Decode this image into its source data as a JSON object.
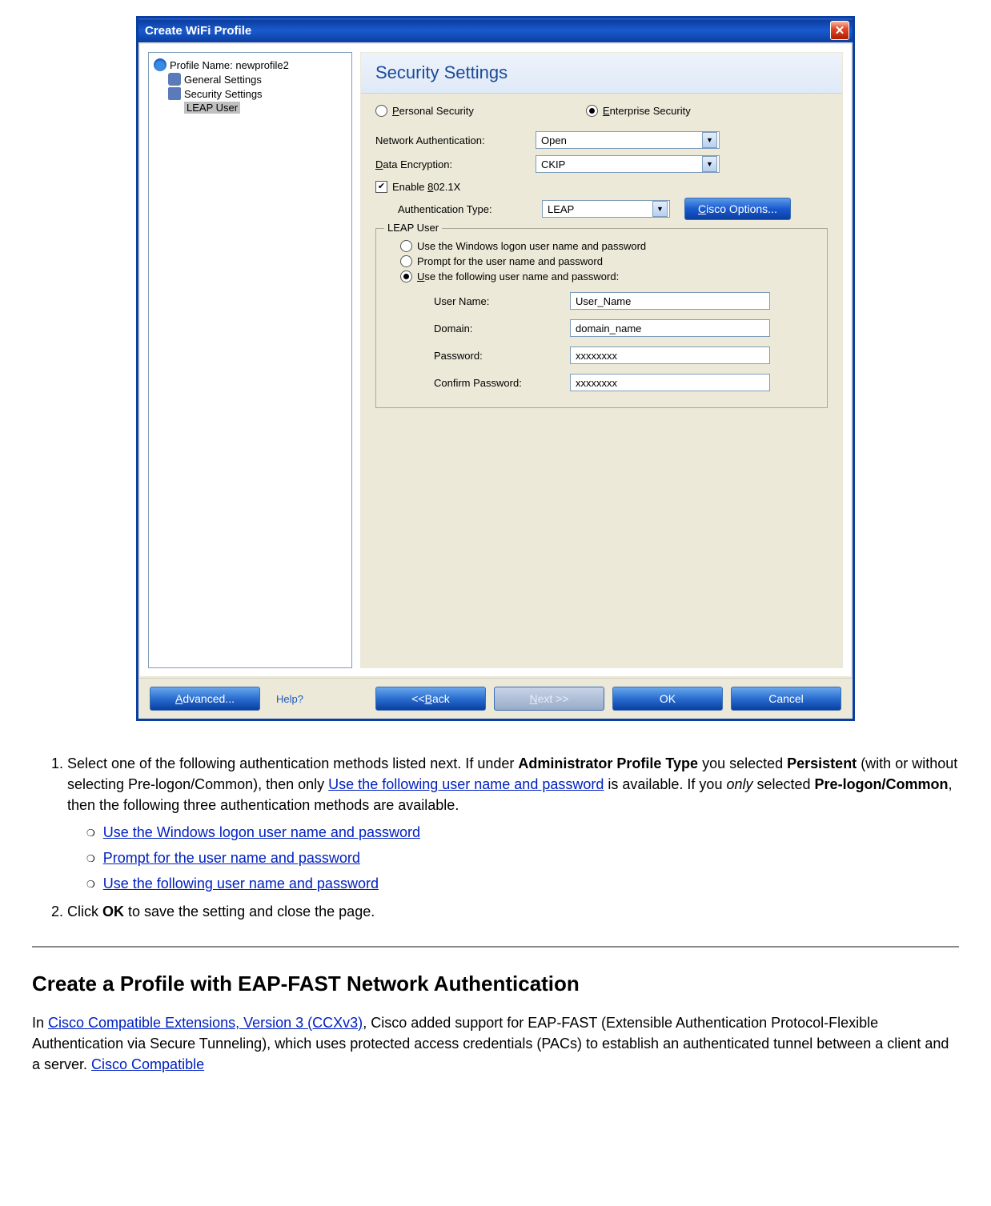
{
  "dialog": {
    "title": "Create WiFi Profile",
    "tree": {
      "profile_label": "Profile Name: newprofile2",
      "general": "General Settings",
      "security": "Security Settings",
      "leap_user": "LEAP User"
    },
    "header": "Security Settings",
    "security_mode": {
      "personal": "Personal Security",
      "enterprise": "Enterprise Security"
    },
    "net_auth": {
      "label": "Network Authentication:",
      "value": "Open"
    },
    "data_enc": {
      "label": "Data Encryption:",
      "value": "CKIP"
    },
    "enable_8021x": "Enable 802.1X",
    "auth_type": {
      "label": "Authentication Type:",
      "value": "LEAP"
    },
    "cisco_btn": "Cisco Options...",
    "leap_group": {
      "legend": "LEAP User",
      "opt_windows": "Use the Windows logon user name and password",
      "opt_prompt": "Prompt for the user name and password",
      "opt_following": "Use the following user name and password:",
      "user_label": "User Name:",
      "user_value": "User_Name",
      "domain_label": "Domain:",
      "domain_value": "domain_name",
      "pw_label": "Password:",
      "pw_value": "xxxxxxxx",
      "cpw_label": "Confirm Password:",
      "cpw_value": "xxxxxxxx"
    },
    "footer": {
      "advanced": "Advanced...",
      "help": "Help?",
      "back": "<< Back",
      "next": "Next >>",
      "ok": "OK",
      "cancel": "Cancel"
    }
  },
  "doc": {
    "step1_a": "Select one of the following authentication methods listed next. If under ",
    "step1_b": "Administrator Profile Type",
    "step1_c": " you selected ",
    "step1_d": "Persistent",
    "step1_e": " (with or without selecting Pre-logon/Common), then only ",
    "step1_link1": "Use the following user name and password",
    "step1_f": " is available. If you ",
    "step1_only": "only",
    "step1_g": " selected ",
    "step1_h": "Pre-logon/Common",
    "step1_i": ", then the following three authentication methods are available.",
    "sub1": "Use the Windows logon user name and password",
    "sub2": "Prompt for the user name and password",
    "sub3": "Use the following user name and password",
    "step2_a": "Click ",
    "step2_b": "OK",
    "step2_c": " to save the setting and close the page.",
    "h2": "Create a Profile with EAP-FAST Network Authentication",
    "p1_a": "In ",
    "p1_link1": "Cisco Compatible Extensions, Version 3 (CCXv3)",
    "p1_b": ", Cisco added support for EAP-FAST (Extensible Authentication Protocol-Flexible Authentication via Secure Tunneling), which uses protected access credentials (PACs) to establish an authenticated tunnel between a client and a server. ",
    "p1_link2": "Cisco Compatible "
  }
}
